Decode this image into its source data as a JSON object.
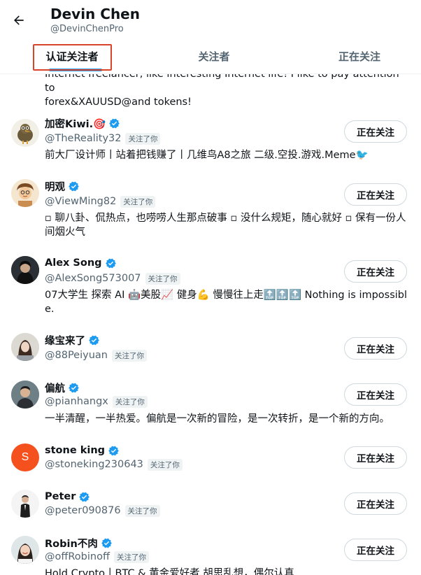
{
  "header": {
    "name": "Devin Chen",
    "handle": "@DevinChenPro"
  },
  "tabs": [
    {
      "label": "认证关注者",
      "active": true
    },
    {
      "label": "关注者",
      "active": false
    },
    {
      "label": "正在关注",
      "active": false
    }
  ],
  "partial_bio": {
    "line1": "Internet freelancer, like interesting Internet life! I like to pay attention to",
    "line2": "forex&XAUUSD@and tokens!"
  },
  "follow_button_label": "正在关注",
  "follows_you_label": "关注了你",
  "colors": {
    "accent": "#1d9bf0",
    "highlight_box": "#d9432a",
    "secondary_text": "#536471"
  },
  "users": [
    {
      "name": "加密Kiwi.🎯",
      "handle": "@TheReality32",
      "follows_you": "关注了你",
      "bio": "前大厂设计师丨站着把钱赚了丨几维鸟A8之旅 二级.空投.游戏.Meme🐦",
      "avatar": "kiwi-bird-icon"
    },
    {
      "name": "明观",
      "handle": "@ViewMing82",
      "follows_you": "关注了你",
      "bio": "▫ 聊八卦、侃热点，也唠唠人生那点破事 ▫ 没什么规矩，随心就好 ▫ 保有一份人间烟火气",
      "avatar": "cartoon-portrait-icon"
    },
    {
      "name": "Alex Song",
      "handle": "@AlexSong573007",
      "follows_you": "关注了你",
      "bio": "07大学生 探索 AI 🤖美股📈 健身💪 慢慢往上走🔝🔝🔝 Nothing is impossible.",
      "avatar": "hooded-person-icon"
    },
    {
      "name": "缘宝来了",
      "handle": "@88Peiyuan",
      "follows_you": "关注了你",
      "bio": "",
      "avatar": "woman-portrait-icon"
    },
    {
      "name": "偏航",
      "handle": "@pianhangx",
      "follows_you": "关注了你",
      "bio": "一半清醒，一半热爱。偏航是一次新的冒险，是一次转折，是一个新的方向。",
      "avatar": "man-portrait-icon"
    },
    {
      "name": "stone king",
      "handle": "@stoneking230643",
      "follows_you": "关注了你",
      "bio": "",
      "avatar": "S"
    },
    {
      "name": "Peter",
      "handle": "@peter090876",
      "follows_you": "关注了你",
      "bio": "",
      "avatar": "suited-man-icon"
    },
    {
      "name": "Robin不肉",
      "handle": "@offRobinoff",
      "follows_you": "关注了你",
      "bio": "Hold Crypto丨BTC & 黄金爱好者 胡思乱想，偶尔认真",
      "avatar": "smiling-woman-icon"
    }
  ]
}
